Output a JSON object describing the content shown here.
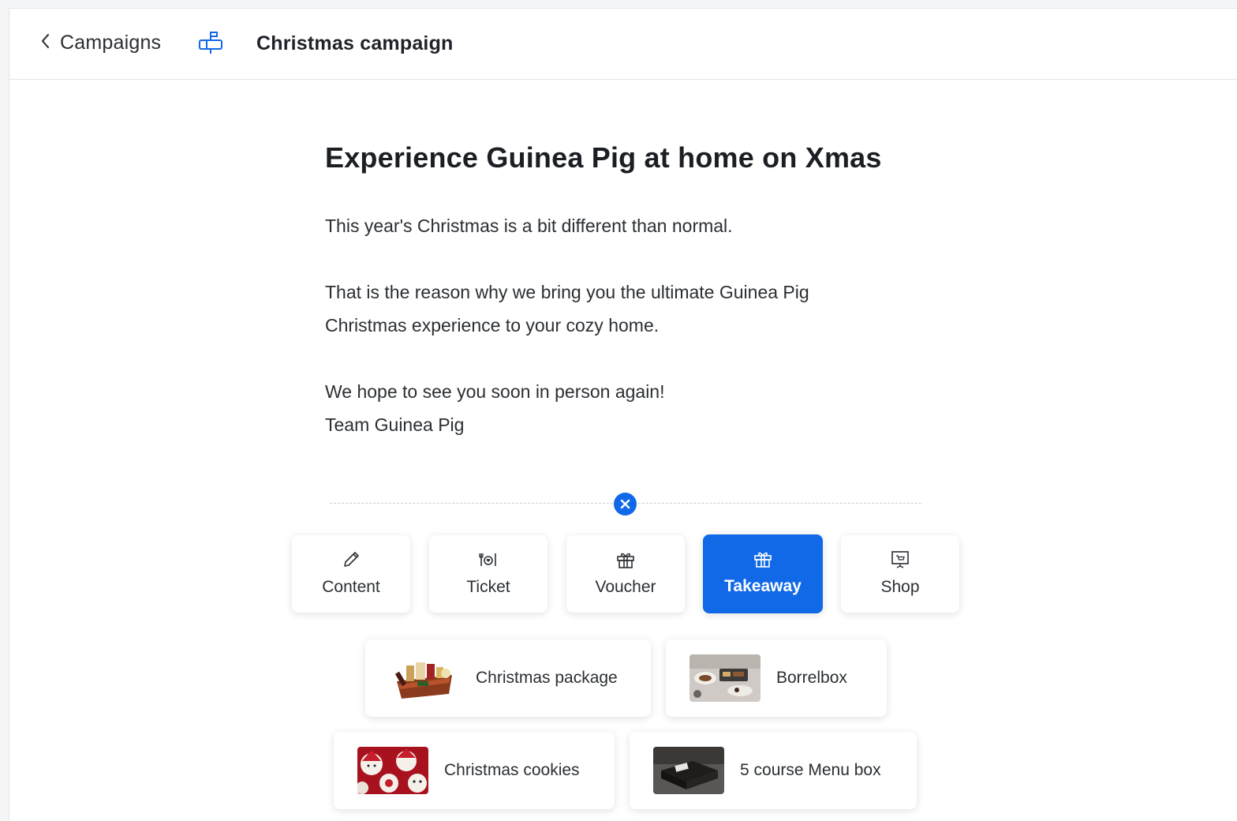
{
  "header": {
    "back_label": "Campaigns",
    "title": "Christmas campaign"
  },
  "content": {
    "headline": "Experience Guinea Pig at home on Xmas",
    "paragraph_1": "This year's Christmas is a bit different than normal.",
    "paragraph_2_line_1": "That is the reason why we bring you the ultimate Guinea Pig",
    "paragraph_2_line_2": "Christmas experience to your cozy home.",
    "paragraph_3_line_1": "We hope to see you soon in person again!",
    "paragraph_3_line_2": "Team Guinea Pig"
  },
  "block_types": [
    {
      "label": "Content",
      "icon": "pencil-icon",
      "active": false
    },
    {
      "label": "Ticket",
      "icon": "ticket-icon",
      "active": false
    },
    {
      "label": "Voucher",
      "icon": "gift-icon",
      "active": false
    },
    {
      "label": "Takeaway",
      "icon": "gift-icon",
      "active": true
    },
    {
      "label": "Shop",
      "icon": "shop-icon",
      "active": false
    }
  ],
  "products": [
    {
      "label": "Christmas package",
      "thumbnail": "christmas-package-image"
    },
    {
      "label": "Borrelbox",
      "thumbnail": "borrelbox-image"
    },
    {
      "label": "Christmas cookies",
      "thumbnail": "christmas-cookies-image"
    },
    {
      "label": "5 course Menu box",
      "thumbnail": "menu-box-image"
    }
  ],
  "colors": {
    "accent": "#1169e8",
    "text": "#1f2329",
    "border": "#e3e5e8"
  }
}
